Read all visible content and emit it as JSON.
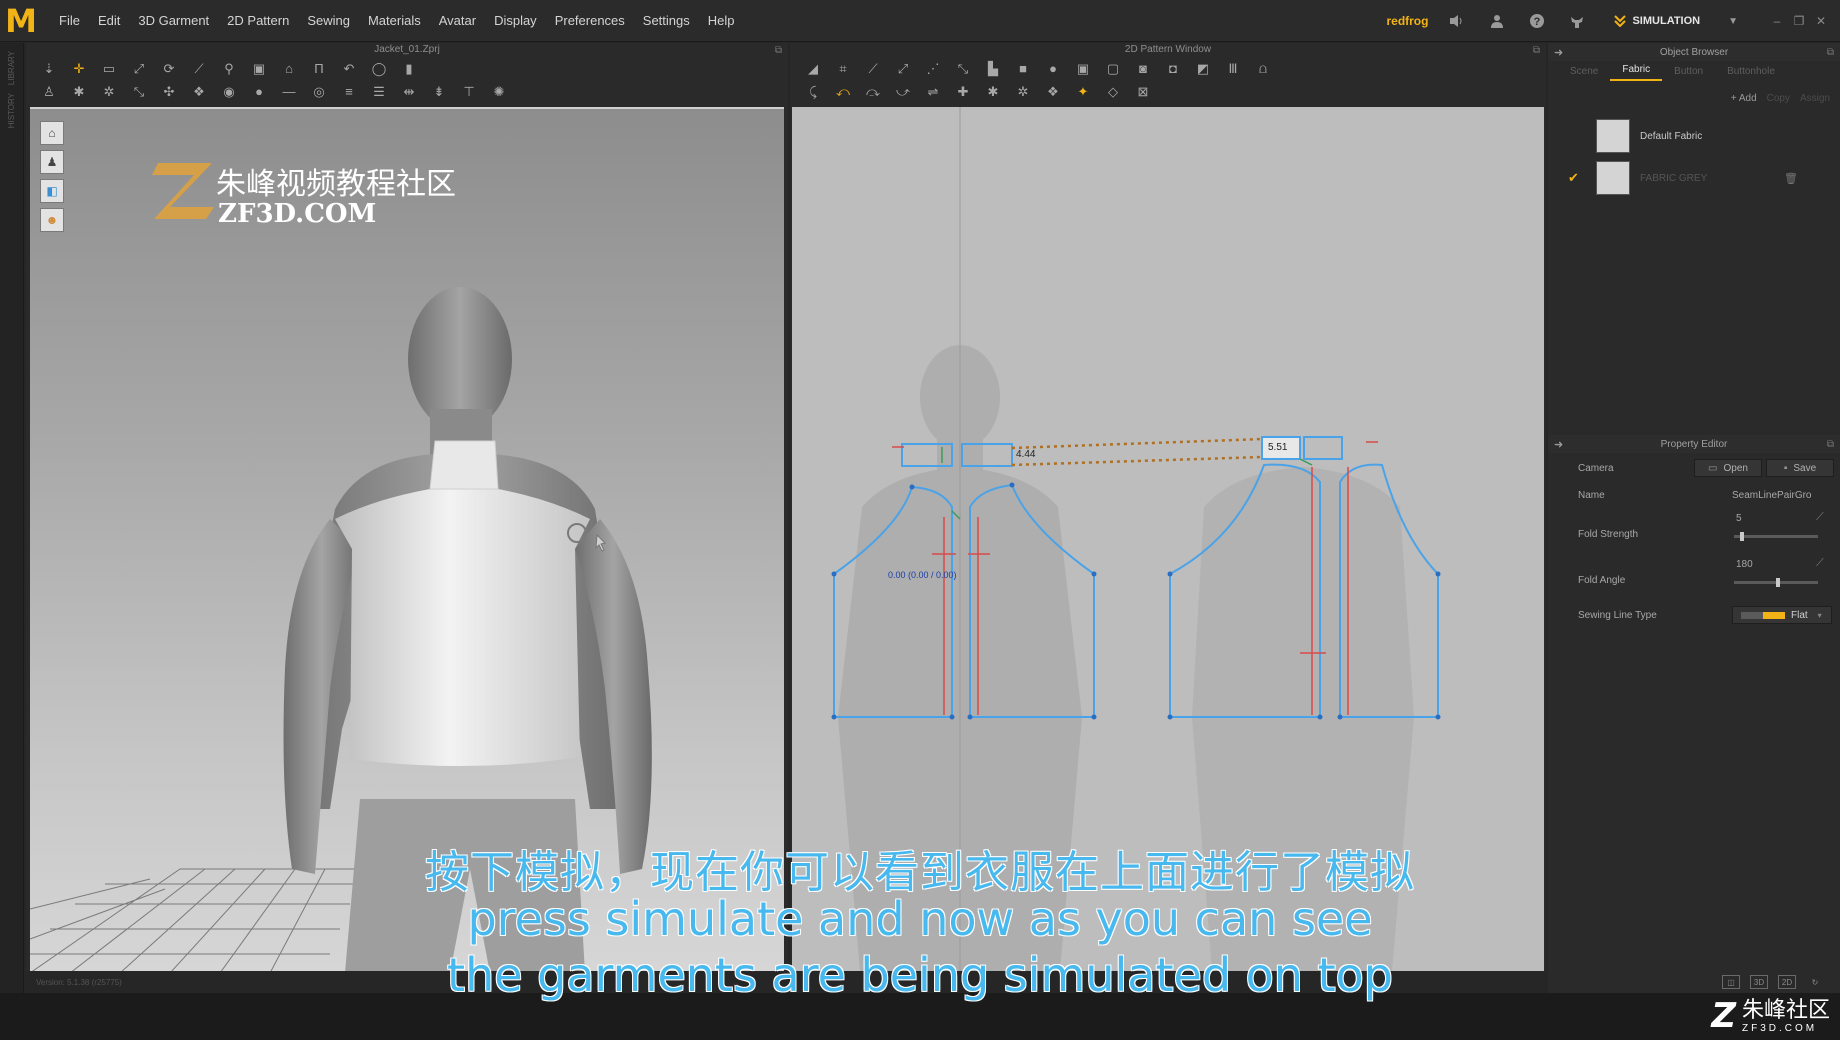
{
  "app": {
    "logo": "M",
    "menu": [
      "File",
      "Edit",
      "3D Garment",
      "2D Pattern",
      "Sewing",
      "Materials",
      "Avatar",
      "Display",
      "Preferences",
      "Settings",
      "Help"
    ],
    "username": "redfrog",
    "mode": "SIMULATION",
    "accent": "#f2b316"
  },
  "left_strip": {
    "labels": [
      "LIBRARY",
      "HISTORY"
    ]
  },
  "panel3d": {
    "title": "Jacket_01.Zprj",
    "watermark_cn": "朱峰视频教程社区",
    "watermark_en": "ZF3D.COM",
    "version": "Version: 5.1.38 (r25775)"
  },
  "panel2d": {
    "title": "2D Pattern Window",
    "measure_1": "4.44",
    "measure_2": "5.51",
    "seam_readout": "0.00 (0.00 / 0.00)"
  },
  "object_browser": {
    "title": "Object Browser",
    "tabs": [
      "Scene",
      "Fabric",
      "Button",
      "Buttonhole"
    ],
    "active_tab": "Fabric",
    "actions": [
      "+ Add",
      "Copy",
      "Assign"
    ],
    "fabrics": [
      "Default Fabric",
      "FABRIC GREY"
    ]
  },
  "property_editor": {
    "title": "Property Editor",
    "camera_label": "Camera",
    "open_label": "Open",
    "save_label": "Save",
    "name_label": "Name",
    "name_value": "SeamLinePairGro",
    "fold_strength_label": "Fold Strength",
    "fold_strength_value": "5",
    "fold_angle_label": "Fold Angle",
    "fold_angle_value": "180",
    "sewing_line_type_label": "Sewing Line Type",
    "sewing_line_type_value": "Flat"
  },
  "subtitles": {
    "cn": "按下模拟，现在你可以看到衣服在上面进行了模拟",
    "en_line1": "press simulate and now as you can see",
    "en_line2": "the garments are being simulated on top"
  },
  "corner_watermark": {
    "cn": "朱峰社区",
    "en": "ZF3D.COM"
  }
}
